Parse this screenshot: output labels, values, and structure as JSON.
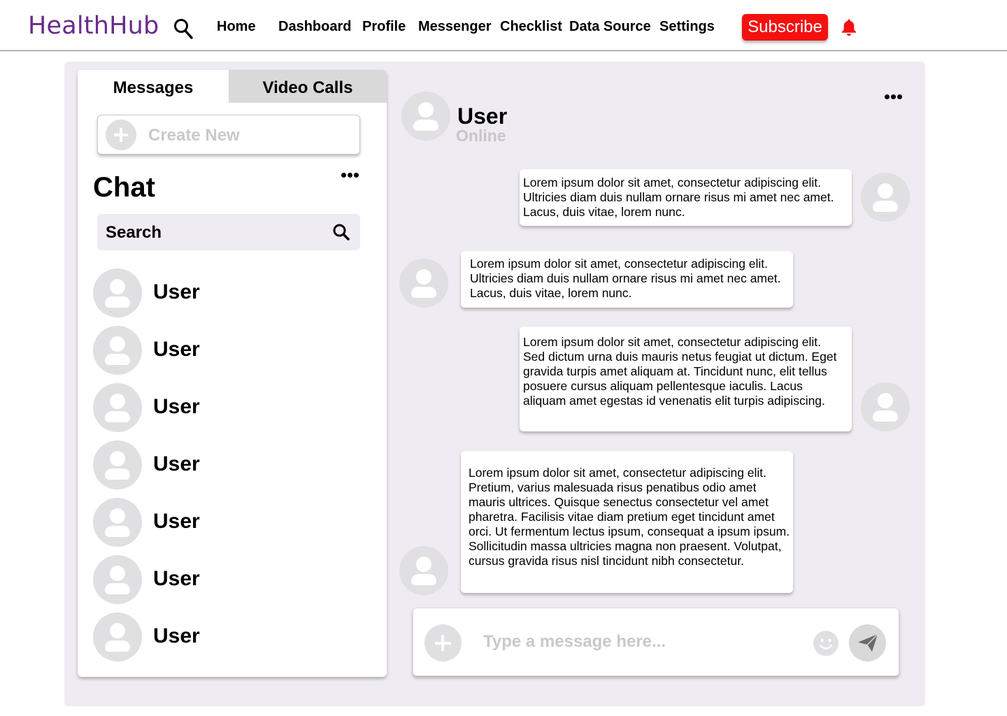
{
  "header": {
    "logo": "HealthHub",
    "nav": [
      "Home",
      "Dashboard",
      "Profile",
      "Messenger",
      "Checklist",
      "Data Source",
      "Settings"
    ],
    "subscribe_label": "Subscribe",
    "icons": {
      "search": "search-icon",
      "notifications": "bell-icon"
    }
  },
  "colors": {
    "brand": "#6a2b8c",
    "subscribe": "#f51010",
    "bell": "#f51010",
    "panel_bg": "#efebf2",
    "avatar": "#e0dfe1",
    "placeholder_text": "#c9c9c9"
  },
  "sidebar": {
    "tabs": [
      "Messages",
      "Video Calls"
    ],
    "active_tab": "Messages",
    "create_new_label": "Create New",
    "chat_title": "Chat",
    "search_placeholder": "Search",
    "users": [
      "User",
      "User",
      "User",
      "User",
      "User",
      "User",
      "User"
    ]
  },
  "conversation": {
    "name": "User",
    "status": "Online",
    "messages": [
      {
        "from": "me",
        "text": "Lorem ipsum dolor sit amet, consectetur adipiscing elit. Ultricies diam duis nullam ornare risus mi amet nec amet. Lacus, duis vitae, lorem nunc."
      },
      {
        "from": "them",
        "text": "Lorem ipsum dolor sit amet, consectetur adipiscing elit. Ultricies diam duis nullam ornare risus mi amet nec amet. Lacus, duis vitae, lorem nunc."
      },
      {
        "from": "me",
        "text": "Lorem ipsum dolor sit amet, consectetur adipiscing elit. Sed dictum urna duis mauris netus feugiat ut dictum. Eget gravida turpis amet aliquam at. Tincidunt nunc, elit tellus posuere cursus aliquam pellentesque iaculis. Lacus aliquam amet egestas id venenatis elit turpis adipiscing."
      },
      {
        "from": "them",
        "text": "Lorem ipsum dolor sit amet, consectetur adipiscing elit. Pretium, varius malesuada risus penatibus odio amet mauris ultrices. Quisque senectus consectetur vel amet pharetra. Facilisis vitae diam pretium eget tincidunt amet orci. Ut fermentum lectus ipsum, consequat a ipsum ipsum. Sollicitudin massa ultricies magna non praesent. Volutpat, cursus gravida risus nisl tincidunt nibh consectetur."
      }
    ],
    "composer_placeholder": "Type a message here...",
    "icons": {
      "more": "more-icon",
      "add": "plus-icon",
      "emoji": "emoji-icon",
      "send": "send-icon"
    }
  }
}
